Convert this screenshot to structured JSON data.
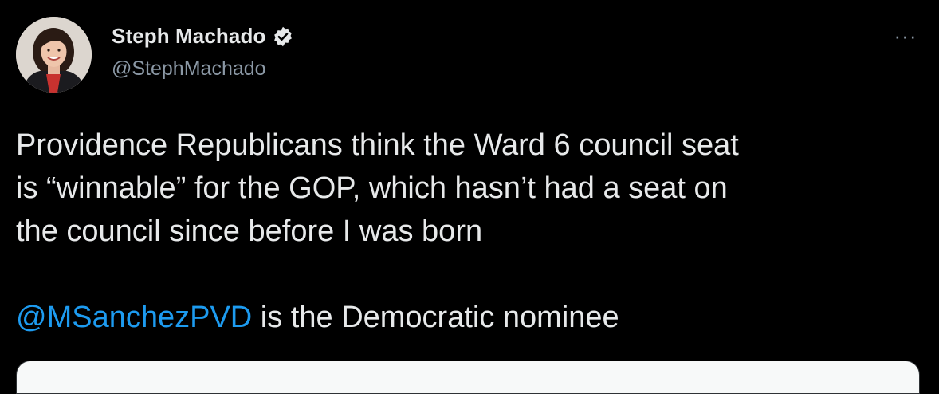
{
  "author": {
    "display_name": "Steph Machado",
    "handle": "@StephMachado",
    "verified": true
  },
  "icons": {
    "verified": "verified-badge-icon",
    "more": "more-options-icon",
    "more_glyph": "···"
  },
  "tweet": {
    "line1": "Providence Republicans think the Ward 6 council seat",
    "line2": "is “winnable” for the GOP, which hasn’t had a seat on",
    "line3": "the council since before I was born",
    "mention": "@MSanchezPVD",
    "mention_suffix": " is the Democratic nominee"
  },
  "colors": {
    "background": "#000000",
    "text": "#e7e9ea",
    "secondary": "#8b98a5",
    "link": "#1d9bf0"
  }
}
